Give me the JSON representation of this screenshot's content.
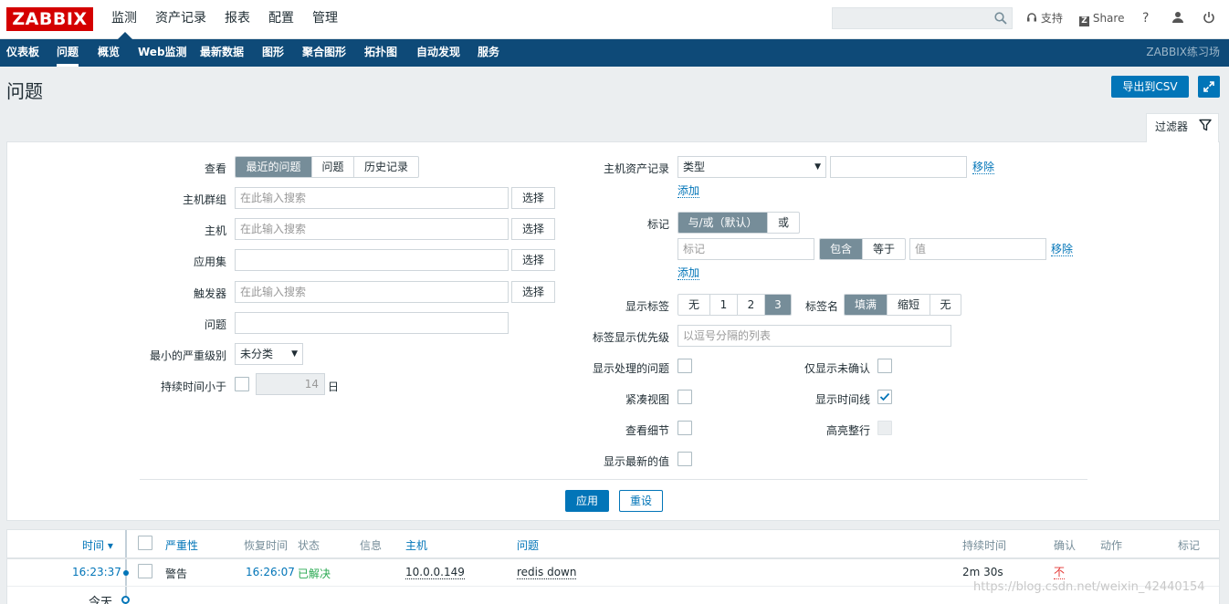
{
  "topbar": {
    "logo": "ZABBIX",
    "menu": [
      "监测",
      "资产记录",
      "报表",
      "配置",
      "管理"
    ],
    "support": "支持",
    "share": "Share",
    "help": "?"
  },
  "subbar": {
    "menu": [
      "仪表板",
      "问题",
      "概览",
      "Web监测",
      "最新数据",
      "图形",
      "聚合图形",
      "拓扑图",
      "自动发现",
      "服务"
    ],
    "server_name": "ZABBIX练习场"
  },
  "header": {
    "title": "问题",
    "export_label": "导出到CSV"
  },
  "filter": {
    "tab_label": "过滤器",
    "show_label": "查看",
    "show_options": [
      "最近的问题",
      "问题",
      "历史记录"
    ],
    "host_groups_label": "主机群组",
    "hosts_label": "主机",
    "application_label": "应用集",
    "triggers_label": "触发器",
    "problem_label": "问题",
    "severity_label": "最小的严重级别",
    "severity_value": "未分类",
    "age_label": "持续时间小于",
    "age_value": "14",
    "age_unit": "日",
    "search_placeholder": "在此输入搜索",
    "select_label": "选择",
    "inventory_label": "主机资产记录",
    "inventory_type": "类型",
    "remove_label": "移除",
    "add_label": "添加",
    "tags_label": "标记",
    "tag_eval_options": [
      "与/或（默认）",
      "或"
    ],
    "tag_placeholder": "标记",
    "tag_op_options": [
      "包含",
      "等于"
    ],
    "tag_value_placeholder": "值",
    "show_tags_label": "显示标签",
    "show_tags_options": [
      "无",
      "1",
      "2",
      "3"
    ],
    "tag_name_label": "标签名",
    "tag_name_options": [
      "填满",
      "缩短",
      "无"
    ],
    "tag_priority_label": "标签显示优先级",
    "tag_priority_placeholder": "以逗号分隔的列表",
    "show_suppressed_label": "显示处理的问题",
    "unack_only_label": "仅显示未确认",
    "compact_label": "紧凑视图",
    "timeline_label": "显示时间线",
    "details_label": "查看细节",
    "highlight_label": "高亮整行",
    "latest_values_label": "显示最新的值",
    "apply_label": "应用",
    "reset_label": "重设"
  },
  "table": {
    "headers": {
      "time": "时间 ▾",
      "severity": "严重性",
      "recovery_time": "恢复时间",
      "status": "状态",
      "info": "信息",
      "host": "主机",
      "problem": "问题",
      "duration": "持续时间",
      "ack": "确认",
      "actions": "动作",
      "tags": "标记"
    },
    "rows": [
      {
        "time": "16:23:37",
        "severity": "警告",
        "recovery_time": "16:26:07",
        "status": "已解决",
        "host": "10.0.0.149",
        "problem": "redis down",
        "duration": "2m 30s",
        "ack": "不"
      }
    ],
    "today_label": "今天"
  },
  "watermark": "https://blog.csdn.net/weixin_42440154",
  "colors": {
    "brand": "#d40000",
    "nav": "#0e4a78",
    "primary": "#0275b8",
    "resolved": "#59db8f",
    "ack_no": "#e33734"
  }
}
